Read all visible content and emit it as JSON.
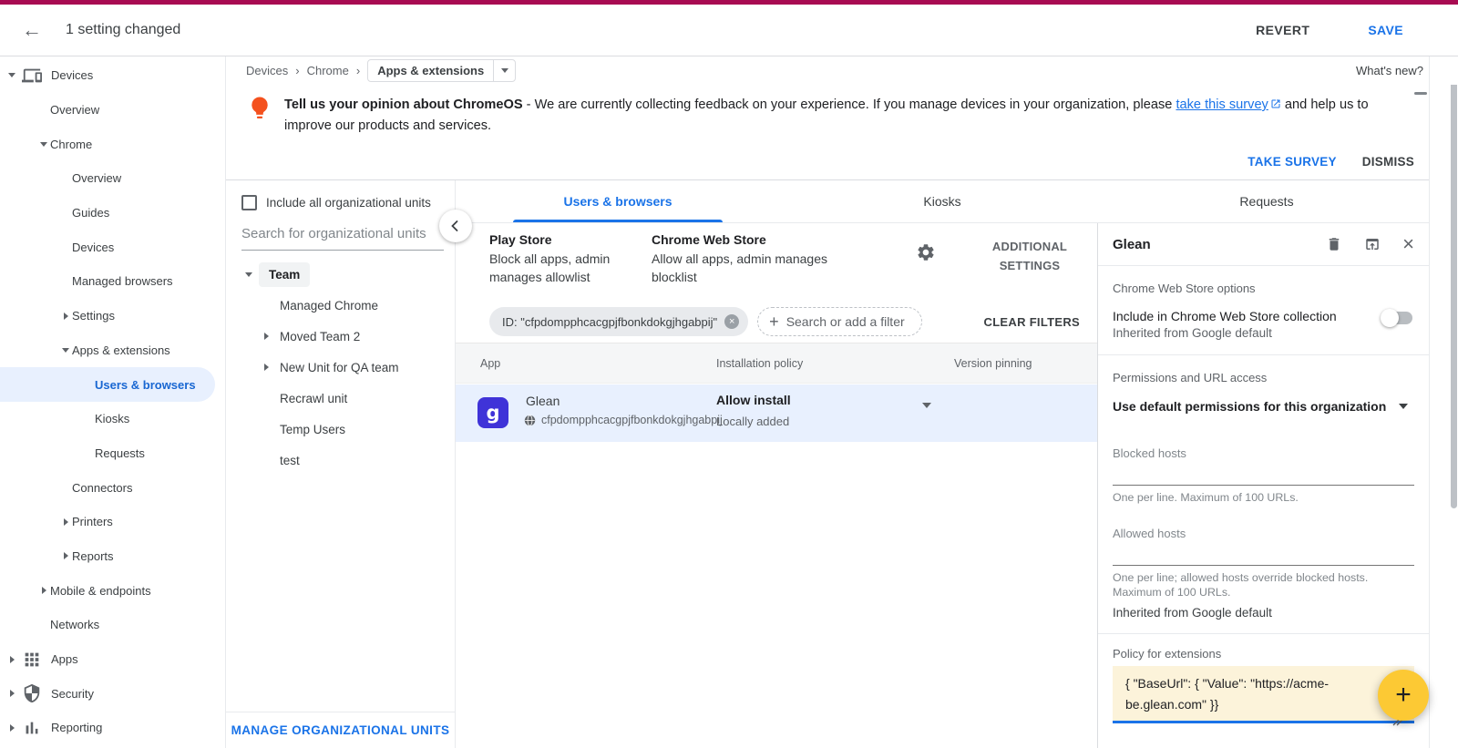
{
  "colors": {
    "accent": "#1a73e8",
    "topstrip": "#a80b52",
    "banner_icon": "#f4511e",
    "fab": "#fcc934",
    "glean_icon_bg": "#3f33d8",
    "selected_bg": "#e8f0fe",
    "policy_bg": "#fcf3da"
  },
  "icons": {
    "back": "←",
    "separator": "›",
    "close": "×",
    "add": "+",
    "remove": "×",
    "app_glyph": "g"
  },
  "appbar": {
    "title": "1 setting changed",
    "revert": "REVERT",
    "save": "SAVE"
  },
  "breadcrumb": {
    "path": [
      "Devices",
      "Chrome"
    ],
    "current": "Apps & extensions",
    "whats_new": "What's new?"
  },
  "sidebar": {
    "items": [
      {
        "label": "Devices",
        "level": 0,
        "caret": "down",
        "icon": "devices"
      },
      {
        "label": "Overview",
        "level": 1,
        "caret": "none"
      },
      {
        "label": "Chrome",
        "level": 1,
        "caret": "down"
      },
      {
        "label": "Overview",
        "level": 2,
        "caret": "none"
      },
      {
        "label": "Guides",
        "level": 2,
        "caret": "none"
      },
      {
        "label": "Devices",
        "level": 2,
        "caret": "none"
      },
      {
        "label": "Managed browsers",
        "level": 2,
        "caret": "none"
      },
      {
        "label": "Settings",
        "level": 2,
        "caret": "right"
      },
      {
        "label": "Apps & extensions",
        "level": 2,
        "caret": "down"
      },
      {
        "label": "Users & browsers",
        "level": 3,
        "caret": "none",
        "selected": true
      },
      {
        "label": "Kiosks",
        "level": 3,
        "caret": "none"
      },
      {
        "label": "Requests",
        "level": 3,
        "caret": "none"
      },
      {
        "label": "Connectors",
        "level": 2,
        "caret": "none"
      },
      {
        "label": "Printers",
        "level": 2,
        "caret": "right"
      },
      {
        "label": "Reports",
        "level": 2,
        "caret": "right"
      },
      {
        "label": "Mobile & endpoints",
        "level": 1,
        "caret": "right"
      },
      {
        "label": "Networks",
        "level": 1,
        "caret": "none"
      },
      {
        "label": "Apps",
        "level": 0,
        "caret": "right",
        "icon": "apps"
      },
      {
        "label": "Security",
        "level": 0,
        "caret": "right",
        "icon": "security"
      },
      {
        "label": "Reporting",
        "level": 0,
        "caret": "right",
        "icon": "reporting"
      }
    ]
  },
  "banner": {
    "title": "Tell us your opinion about ChromeOS",
    "body_1": " - We are currently collecting feedback on your experience. If you manage devices in your organization, please ",
    "link": "take this survey",
    "body_2": " and help us to improve our products and services.",
    "take_survey": "TAKE SURVEY",
    "dismiss": "DISMISS"
  },
  "ou": {
    "include_all": "Include all organizational units",
    "search_placeholder": "Search for organizational units",
    "tree": [
      {
        "label": "Team",
        "level": 0,
        "caret": "down",
        "selected": true
      },
      {
        "label": "Managed Chrome",
        "level": 1,
        "caret": "none"
      },
      {
        "label": "Moved Team 2",
        "level": 1,
        "caret": "right"
      },
      {
        "label": "New Unit for QA team",
        "level": 1,
        "caret": "right"
      },
      {
        "label": "Recrawl unit",
        "level": 1,
        "caret": "none"
      },
      {
        "label": "Temp Users",
        "level": 1,
        "caret": "none"
      },
      {
        "label": "test",
        "level": 1,
        "caret": "none"
      }
    ],
    "manage": "MANAGE ORGANIZATIONAL UNITS"
  },
  "tabs": [
    {
      "label": "Users & browsers",
      "active": true
    },
    {
      "label": "Kiosks",
      "active": false
    },
    {
      "label": "Requests",
      "active": false
    }
  ],
  "stores": {
    "play_title": "Play Store",
    "play_desc": "Block all apps, admin manages allowlist",
    "cws_title": "Chrome Web Store",
    "cws_desc": "Allow all apps, admin manages blocklist",
    "additional": "ADDITIONAL SETTINGS"
  },
  "filters": {
    "chip": "ID: \"cfpdompphcacgpjfbonkdokgjhgabpij\"",
    "add_placeholder": "Search or add a filter",
    "clear": "CLEAR FILTERS"
  },
  "table": {
    "columns": [
      "App",
      "Installation policy",
      "Version pinning"
    ],
    "rows": [
      {
        "name": "Glean",
        "id": "cfpdompphcacgpjfbonkdokgjhgabpij",
        "policy": "Allow install",
        "policy_source": "Locally added"
      }
    ]
  },
  "detail": {
    "title": "Glean",
    "cws_options_label": "Chrome Web Store options",
    "collection_label": "Include in Chrome Web Store collection",
    "collection_sub": "Inherited from Google default",
    "collection_toggle": "off",
    "permissions_label": "Permissions and URL access",
    "permissions_value": "Use default permissions for this organization",
    "blocked_label": "Blocked hosts",
    "blocked_helper": "One per line. Maximum of 100 URLs.",
    "allowed_label": "Allowed hosts",
    "allowed_helper": "One per line; allowed hosts override blocked hosts. Maximum of 100 URLs.",
    "inherited": "Inherited from Google default",
    "policy_label": "Policy for extensions",
    "policy_value": "{ \"BaseUrl\": { \"Value\": \"https://acme-be.glean.com\" }}"
  }
}
